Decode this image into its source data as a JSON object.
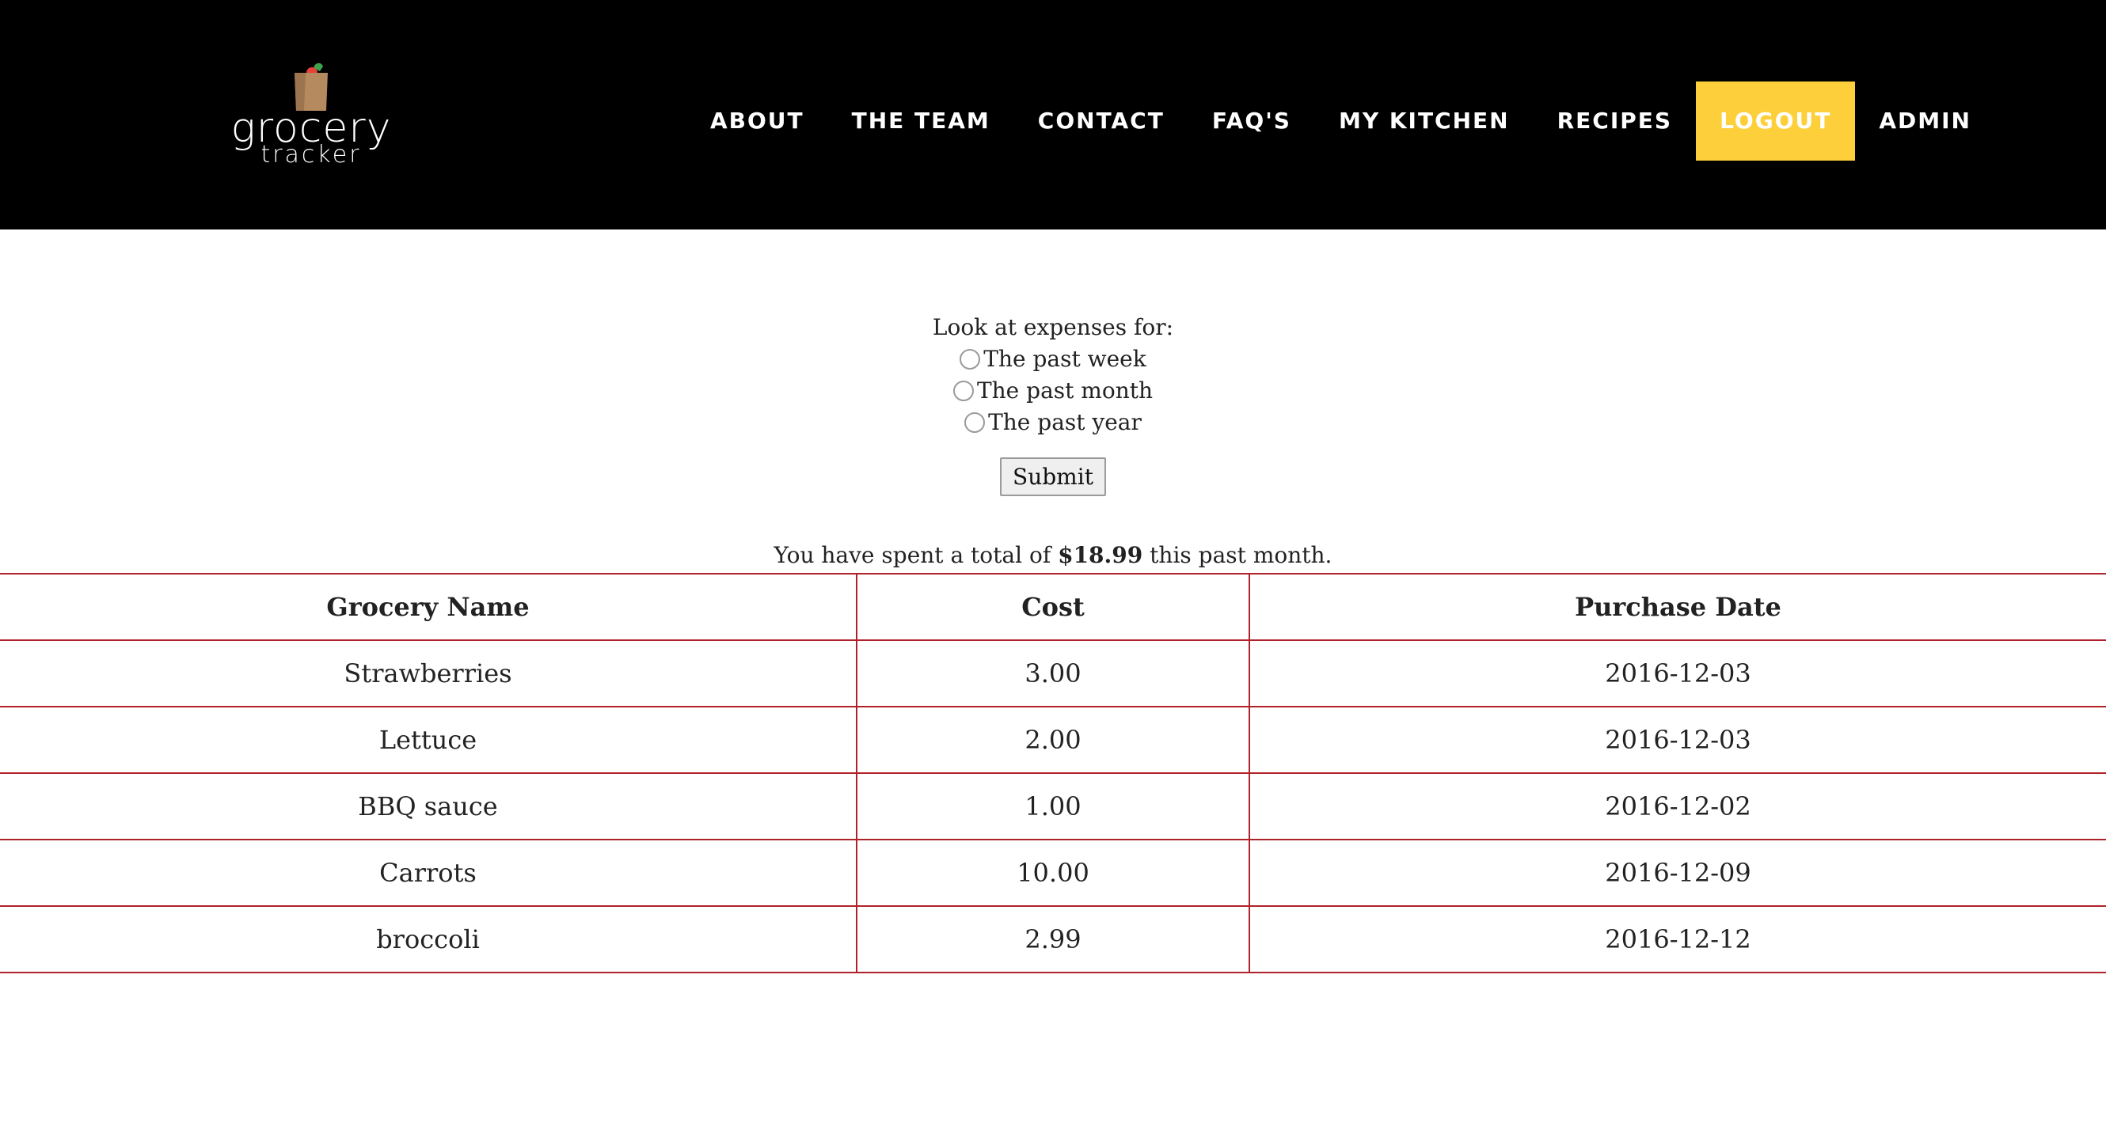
{
  "brand": {
    "name_main": "grocery",
    "name_sub": "tracker",
    "accent_color": "#fdcf3a",
    "table_border_color": "#b0222a",
    "header_bg": "#000000"
  },
  "nav": {
    "items": [
      {
        "label": "ABOUT",
        "active": false
      },
      {
        "label": "THE TEAM",
        "active": false
      },
      {
        "label": "CONTACT",
        "active": false
      },
      {
        "label": "FAQ'S",
        "active": false
      },
      {
        "label": "MY KITCHEN",
        "active": false
      },
      {
        "label": "RECIPES",
        "active": false
      },
      {
        "label": "LOGOUT",
        "active": true
      },
      {
        "label": "ADMIN",
        "active": false
      }
    ]
  },
  "expense_form": {
    "prompt": "Look at expenses for:",
    "options": [
      {
        "label": "The past week",
        "checked": false
      },
      {
        "label": "The past month",
        "checked": false
      },
      {
        "label": "The past year",
        "checked": false
      }
    ],
    "submit_label": "Submit"
  },
  "summary": {
    "prefix": "You have spent a total of",
    "amount": "$18.99",
    "suffix": "this past month."
  },
  "table": {
    "headers": [
      "Grocery Name",
      "Cost",
      "Purchase Date"
    ],
    "rows": [
      [
        "Strawberries",
        "3.00",
        "2016-12-03"
      ],
      [
        "Lettuce",
        "2.00",
        "2016-12-03"
      ],
      [
        "BBQ sauce",
        "1.00",
        "2016-12-02"
      ],
      [
        "Carrots",
        "10.00",
        "2016-12-09"
      ],
      [
        "broccoli",
        "2.99",
        "2016-12-12"
      ]
    ]
  }
}
